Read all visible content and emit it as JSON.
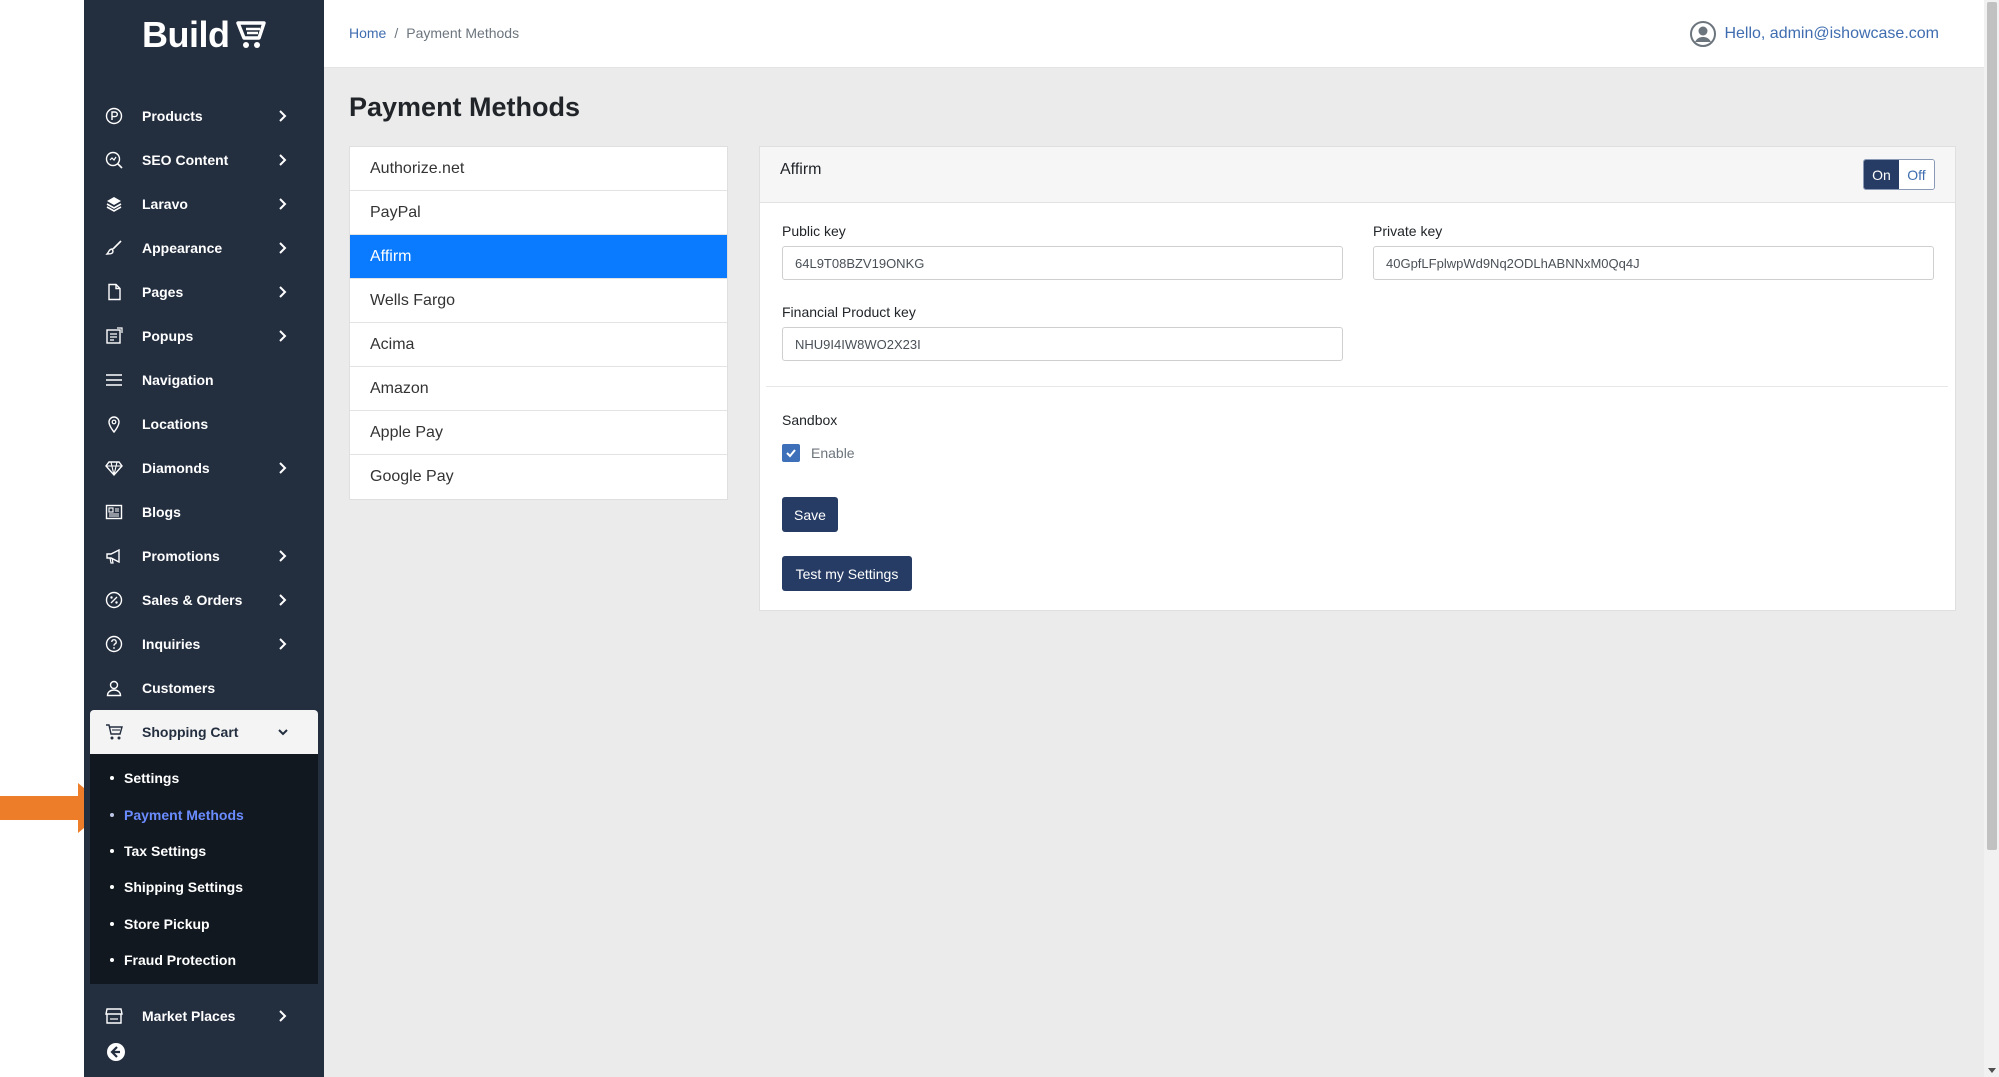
{
  "brand": {
    "logo_text": "Build"
  },
  "sidebar": {
    "items": [
      {
        "label": "Products",
        "icon": "products-icon",
        "chevron": true
      },
      {
        "label": "SEO Content",
        "icon": "seo-icon",
        "chevron": true
      },
      {
        "label": "Laravo",
        "icon": "layers-icon",
        "chevron": true
      },
      {
        "label": "Appearance",
        "icon": "brush-icon",
        "chevron": true
      },
      {
        "label": "Pages",
        "icon": "page-icon",
        "chevron": true
      },
      {
        "label": "Popups",
        "icon": "popup-icon",
        "chevron": true
      },
      {
        "label": "Navigation",
        "icon": "menu-icon",
        "chevron": false
      },
      {
        "label": "Locations",
        "icon": "location-pin-icon",
        "chevron": false
      },
      {
        "label": "Diamonds",
        "icon": "diamond-icon",
        "chevron": true
      },
      {
        "label": "Blogs",
        "icon": "blog-icon",
        "chevron": false
      },
      {
        "label": "Promotions",
        "icon": "megaphone-icon",
        "chevron": true
      },
      {
        "label": "Sales & Orders",
        "icon": "percent-icon",
        "chevron": true
      },
      {
        "label": "Inquiries",
        "icon": "question-icon",
        "chevron": true
      },
      {
        "label": "Customers",
        "icon": "user-icon",
        "chevron": false
      }
    ],
    "active_group": {
      "label": "Shopping Cart",
      "icon": "cart-icon"
    },
    "subitems": [
      {
        "label": "Settings"
      },
      {
        "label": "Payment Methods"
      },
      {
        "label": "Tax Settings"
      },
      {
        "label": "Shipping Settings"
      },
      {
        "label": "Store Pickup"
      },
      {
        "label": "Fraud Protection"
      }
    ],
    "bottom_item": {
      "label": "Market Places",
      "icon": "store-icon"
    }
  },
  "header": {
    "breadcrumb_home": "Home",
    "breadcrumb_sep": "/",
    "breadcrumb_current": "Payment Methods",
    "user_greeting": "Hello, admin@ishowcase.com"
  },
  "main": {
    "title": "Payment Methods",
    "methods": [
      "Authorize.net",
      "PayPal",
      "Affirm",
      "Wells Fargo",
      "Acima",
      "Amazon",
      "Apple Pay",
      "Google Pay"
    ],
    "selected_method": "Affirm"
  },
  "panel": {
    "title": "Affirm",
    "toggle_on": "On",
    "toggle_off": "Off",
    "public_key_label": "Public key",
    "public_key_value": "64L9T08BZV19ONKG",
    "private_key_label": "Private key",
    "private_key_value": "40GpfLFplwpWd9Nq2ODLhABNNxM0Qq4J",
    "financial_key_label": "Financial Product key",
    "financial_key_value": "NHU9I4IW8WO2X23I",
    "sandbox_label": "Sandbox",
    "enable_label": "Enable",
    "save_label": "Save",
    "test_label": "Test my Settings"
  },
  "colors": {
    "sidebar_bg": "#232e3f",
    "active_method": "#0a7bff",
    "button_bg": "#273c64",
    "link": "#3f6db0",
    "indicator_arrow": "#ee7d2a"
  }
}
